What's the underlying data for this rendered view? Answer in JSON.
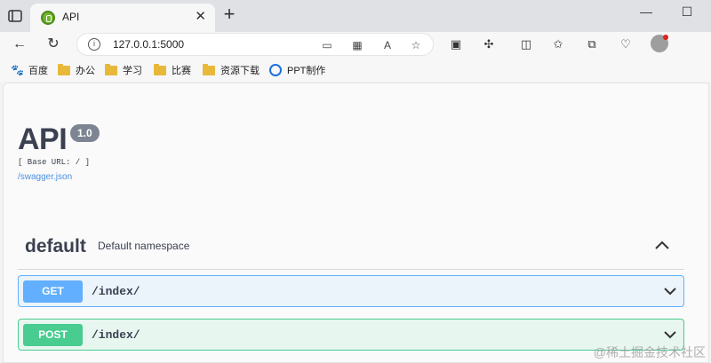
{
  "browser": {
    "tab": {
      "title": "API"
    },
    "address": {
      "url": "127.0.0.1:5000"
    },
    "bookmarks": [
      {
        "label": "百度",
        "icon": "baidu-icon"
      },
      {
        "label": "办公",
        "icon": "folder-icon"
      },
      {
        "label": "学习",
        "icon": "folder-icon"
      },
      {
        "label": "比赛",
        "icon": "folder-icon"
      },
      {
        "label": "资源下载",
        "icon": "folder-icon"
      },
      {
        "label": "PPT制作",
        "icon": "ppt-icon"
      }
    ]
  },
  "swagger": {
    "title": "API",
    "version": "1.0",
    "base_url": "[ Base URL: / ]",
    "spec_link": "/swagger.json",
    "namespace": {
      "name": "default",
      "description": "Default namespace"
    },
    "operations": [
      {
        "method": "GET",
        "path": "/index/",
        "color": "#61affe"
      },
      {
        "method": "POST",
        "path": "/index/",
        "color": "#49cc90"
      }
    ]
  },
  "watermark": "@稀土掘金技术社区"
}
